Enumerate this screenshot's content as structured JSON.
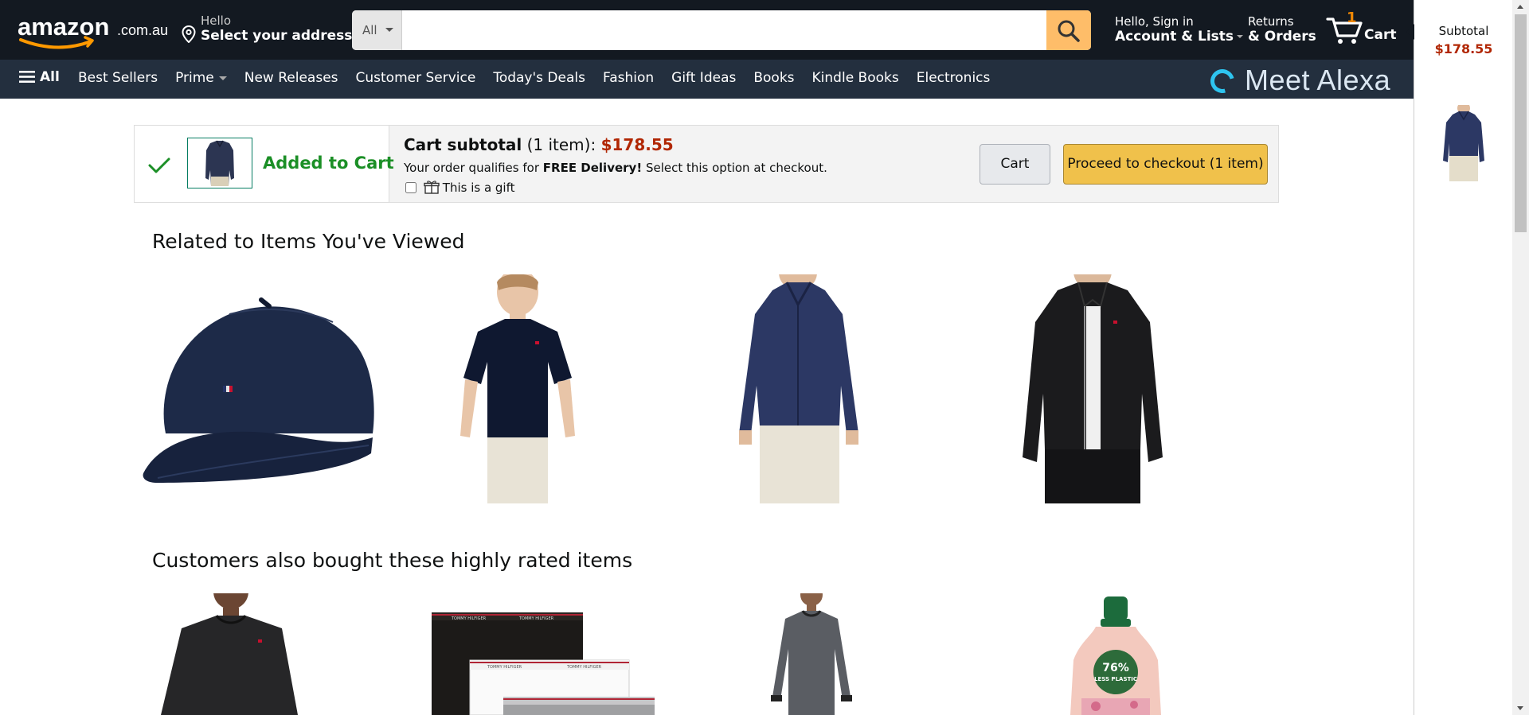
{
  "header": {
    "logo_text": "amazon",
    "logo_domain": ".com.au",
    "location_line1": "Hello",
    "location_line2": "Select your address",
    "search_category": "All",
    "search_placeholder": "",
    "account_line1": "Hello, Sign in",
    "account_line2": "Account & Lists",
    "returns_line1": "Returns",
    "returns_line2": "& Orders",
    "cart_count": "1",
    "cart_label": "Cart"
  },
  "subnav": {
    "all_label": "All",
    "items": [
      "Best Sellers",
      "Prime",
      "New Releases",
      "Customer Service",
      "Today's Deals",
      "Fashion",
      "Gift Ideas",
      "Books",
      "Kindle Books",
      "Electronics"
    ],
    "promo": "Meet Alexa"
  },
  "added_to_cart": {
    "status": "Added to Cart",
    "subtotal_label": "Cart subtotal",
    "subtotal_count": "(1 item):",
    "subtotal_price": "$178.55",
    "qualifies_pre": "Your order qualifies for",
    "qualifies_bold": "FREE Delivery!",
    "qualifies_post": "Select this option at checkout.",
    "gift_label": "This is a gift",
    "cart_button": "Cart",
    "checkout_button": "Proceed to checkout (1 item)"
  },
  "sections": [
    {
      "title": "Related to Items You've Viewed"
    },
    {
      "title": "Customers also bought these highly rated items"
    }
  ],
  "side_panel": {
    "subtotal_label": "Subtotal",
    "subtotal_price": "$178.55"
  },
  "colors": {
    "nav_bg": "#131921",
    "subnav_bg": "#232f3e",
    "search_button": "#febd69",
    "price": "#b12704",
    "added_green": "#1b8f26",
    "checkout_yellow": "#f0c14b"
  }
}
